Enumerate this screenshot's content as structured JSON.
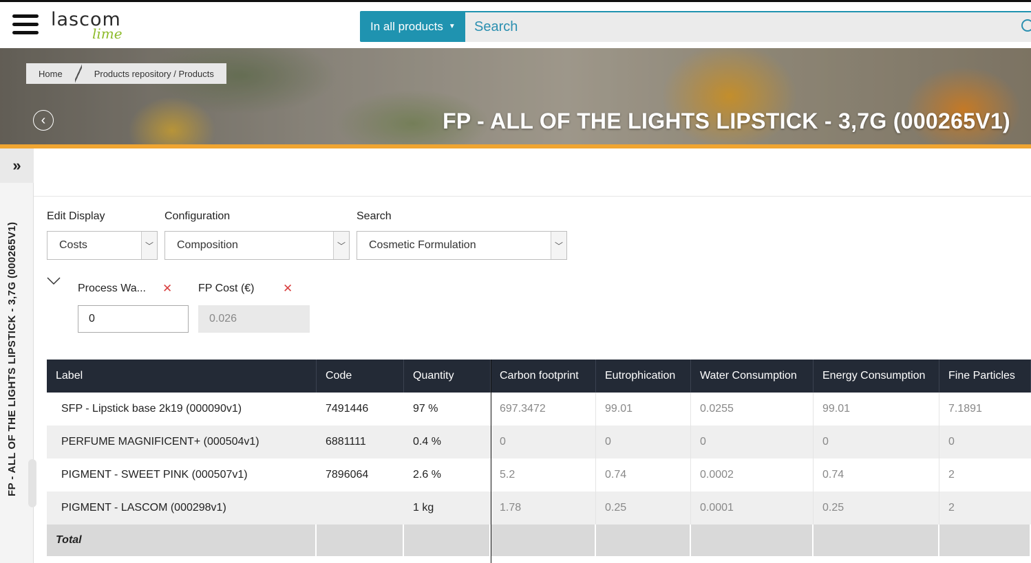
{
  "header": {
    "logo_main": "lascom",
    "logo_sub": "lime",
    "scope_label": "In all products",
    "search_placeholder": "Search"
  },
  "breadcrumb": [
    "Home",
    "Products repository / Products"
  ],
  "page_title": "FP - ALL OF THE LIGHTS LIPSTICK - 3,7G (000265V1)",
  "side_panel": {
    "toggle": "»",
    "label": "FP - ALL OF THE LIGHTS LIPSTICK - 3,7G (000265V1)"
  },
  "filters": {
    "edit_display": {
      "label": "Edit Display",
      "value": "Costs"
    },
    "configuration": {
      "label": "Configuration",
      "value": "Composition"
    },
    "search": {
      "label": "Search",
      "value": "Cosmetic Formulation"
    }
  },
  "fields": [
    {
      "label": "Process Wa...",
      "value": "0",
      "readonly": false
    },
    {
      "label": "FP Cost (€)",
      "value": "0.026",
      "readonly": true
    }
  ],
  "table": {
    "columns": [
      "Label",
      "Code",
      "Quantity",
      "Carbon footprint",
      "Eutrophication",
      "Water Consumption",
      "Energy Consumption",
      "Fine Particles"
    ],
    "rows": [
      [
        "SFP - Lipstick base 2k19 (000090v1)",
        "7491446",
        "97 %",
        "697.3472",
        "99.01",
        "0.0255",
        "99.01",
        "7.1891"
      ],
      [
        "PERFUME MAGNIFICENT+ (000504v1)",
        "6881111",
        "0.4 %",
        "0",
        "0",
        "0",
        "0",
        "0"
      ],
      [
        "PIGMENT - SWEET PINK (000507v1)",
        "7896064",
        "2.6 %",
        "5.2",
        "0.74",
        "0.0002",
        "0.74",
        "2"
      ],
      [
        "PIGMENT - LASCOM (000298v1)",
        "",
        "1 kg",
        "1.78",
        "0.25",
        "0.0001",
        "0.25",
        "2"
      ]
    ],
    "total_label": "Total"
  },
  "colors": {
    "accent": "#1f93b0",
    "header_dark": "#232a36",
    "banner_bar": "#f0a531",
    "remove_x": "#d94040"
  }
}
